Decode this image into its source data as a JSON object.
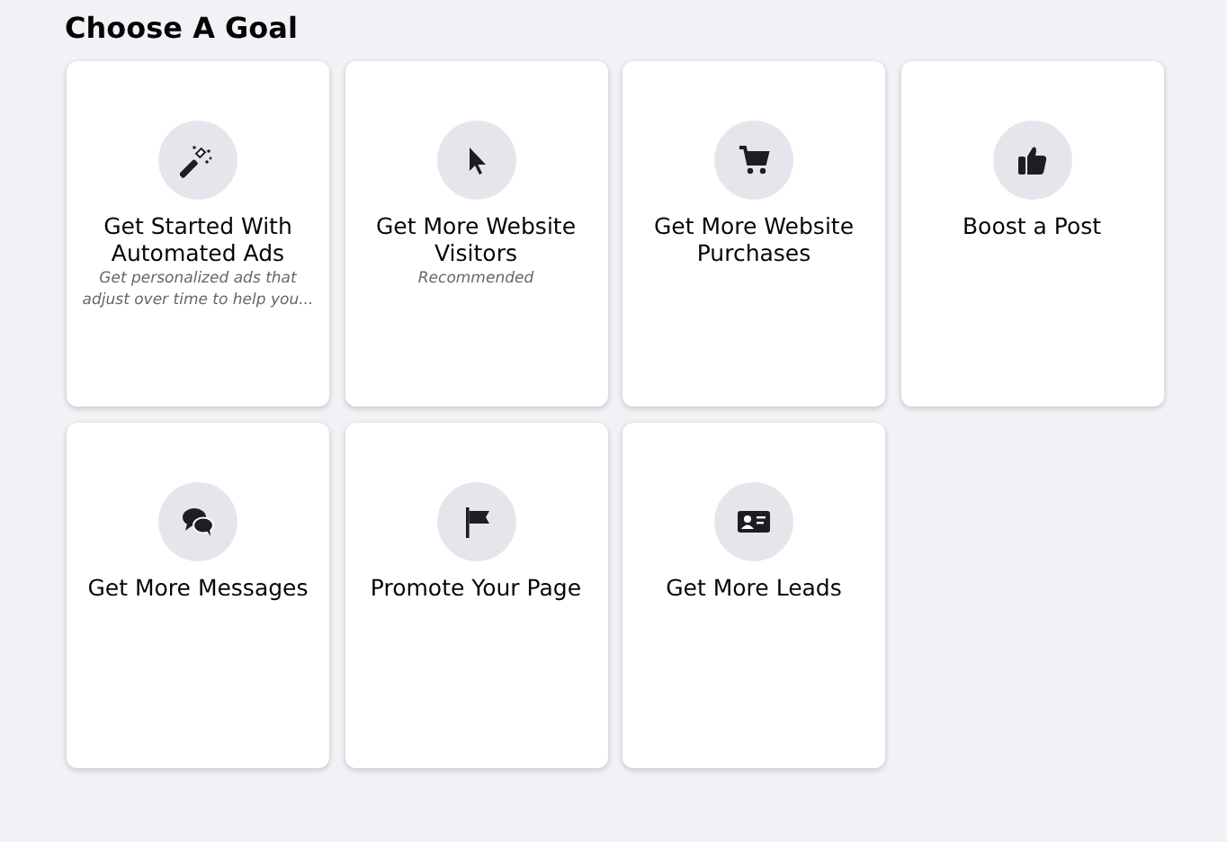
{
  "title": "Choose A Goal",
  "goals": [
    {
      "kind": "wand",
      "label": "Get Started With Automated Ads",
      "subtitle": "Get personalized ads that adjust over time to help you..."
    },
    {
      "kind": "cursor",
      "label": "Get More Website Visitors",
      "subtitle": "Recommended"
    },
    {
      "kind": "cart",
      "label": "Get More Website Purchases"
    },
    {
      "kind": "thumb",
      "label": "Boost a Post"
    },
    {
      "kind": "chat",
      "label": "Get More Messages"
    },
    {
      "kind": "flag",
      "label": "Promote Your Page"
    },
    {
      "kind": "card",
      "label": "Get More Leads"
    }
  ]
}
